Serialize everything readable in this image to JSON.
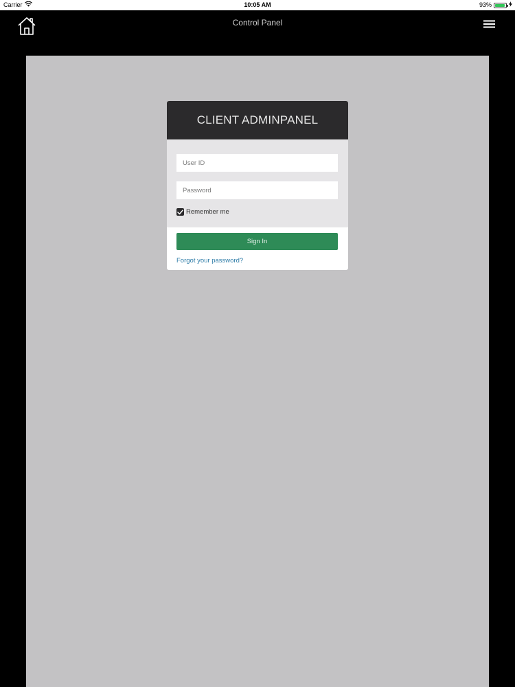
{
  "status_bar": {
    "carrier": "Carrier",
    "time": "10:05 AM",
    "battery_percent_text": "93%",
    "battery_level": 0.93,
    "battery_color": "#33c759"
  },
  "nav": {
    "title": "Control Panel",
    "home_icon": "home-icon",
    "menu_icon": "hamburger-menu-icon"
  },
  "login": {
    "header_title": "CLIENT ADMINPANEL",
    "user_id": {
      "value": "",
      "placeholder": "User ID"
    },
    "password": {
      "value": "",
      "placeholder": "Password"
    },
    "remember_me": {
      "label": "Remember me",
      "checked": true
    },
    "sign_in_label": "Sign In",
    "forgot_password_label": "Forgot your password?"
  },
  "colors": {
    "background": "#000000",
    "content_panel": "#c3c2c4",
    "card_header": "#2b2a2c",
    "sign_in_button": "#2e8b57",
    "link": "#2f7da8"
  }
}
